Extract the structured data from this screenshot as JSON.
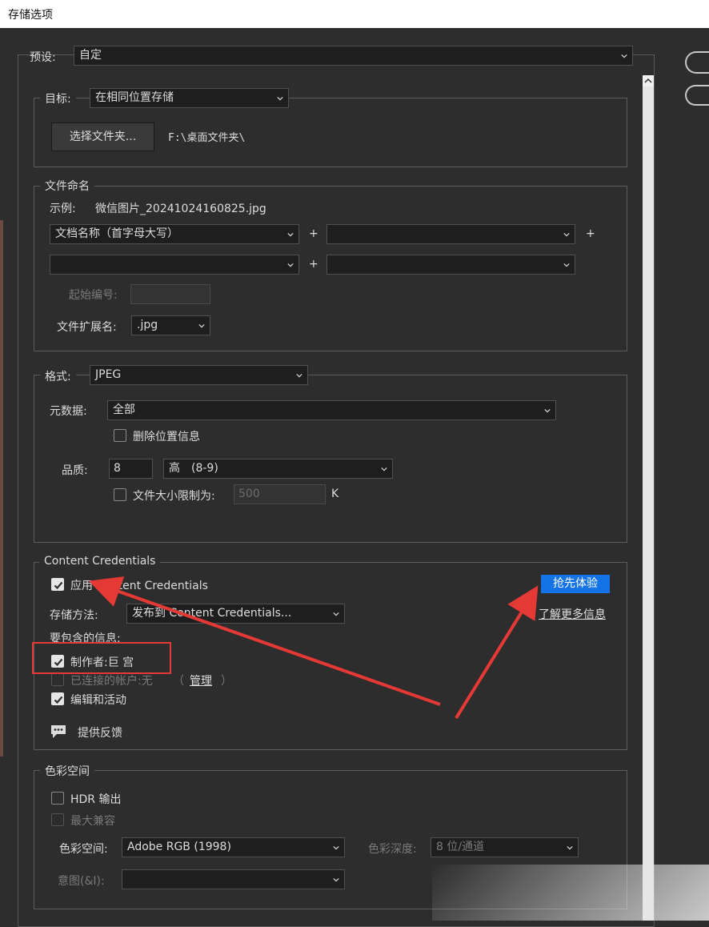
{
  "window": {
    "title": "存储选项"
  },
  "preset": {
    "label": "预设:",
    "value": "自定"
  },
  "destination": {
    "label": "目标:",
    "value": "在相同位置存储",
    "choose_folder_label": "选择文件夹...",
    "folder_path": "F:\\桌面文件夹\\"
  },
  "file_naming": {
    "legend": "文件命名",
    "example_label": "示例:",
    "example_value": "微信图片_20241024160825.jpg",
    "field1": "文档名称（首字母大写）",
    "field2": "",
    "field3": "",
    "field4": "",
    "plus": "+",
    "start_number_label": "起始编号:",
    "start_number_value": "",
    "ext_label": "文件扩展名:",
    "ext_value": ".jpg"
  },
  "format": {
    "label": "格式:",
    "value": "JPEG",
    "metadata_label": "元数据:",
    "metadata_value": "全部",
    "remove_location_label": "删除位置信息",
    "remove_location_checked": false,
    "quality_label": "品质:",
    "quality_value": "8",
    "quality_preset": "高　(8-9)",
    "size_limit_label": "文件大小限制为:",
    "size_limit_checked": false,
    "size_limit_value": "500",
    "size_unit": "K"
  },
  "content_credentials": {
    "legend": "Content Credentials",
    "apply_label": "应用 Content Credentials",
    "apply_checked": true,
    "early_access_label": "抢先体验",
    "storage_label": "存储方法:",
    "storage_value": "发布到 Content Credentials...",
    "learn_more_label": "了解更多信息",
    "include_label": "要包含的信息:",
    "producer_label": "制作者:巨 宫",
    "producer_checked": true,
    "connected_label": "已连接的帐户:无",
    "connected_paren_open": "（",
    "manage_label": "管理",
    "connected_paren_close": "）",
    "edits_label": "编辑和活动",
    "edits_checked": true,
    "feedback_label": "提供反馈"
  },
  "color_space": {
    "legend": "色彩空间",
    "hdr_label": "HDR 输出",
    "hdr_checked": false,
    "max_compat_label": "最大兼容",
    "max_compat_checked": false,
    "space_label": "色彩空间:",
    "space_value": "Adobe RGB (1998)",
    "depth_label": "色彩深度:",
    "depth_value": "8 位/通道",
    "intent_label": "意图(&I):",
    "intent_value": ""
  },
  "colors": {
    "background": "#2d2d2d",
    "accent_blue": "#1473e6",
    "annotation_red": "#e53935"
  },
  "icons": {
    "dropdown": "chevron-down-icon",
    "check": "checkmark-icon",
    "feedback": "speech-bubble-icon",
    "scroll_up": "scroll-up-arrow-icon"
  }
}
